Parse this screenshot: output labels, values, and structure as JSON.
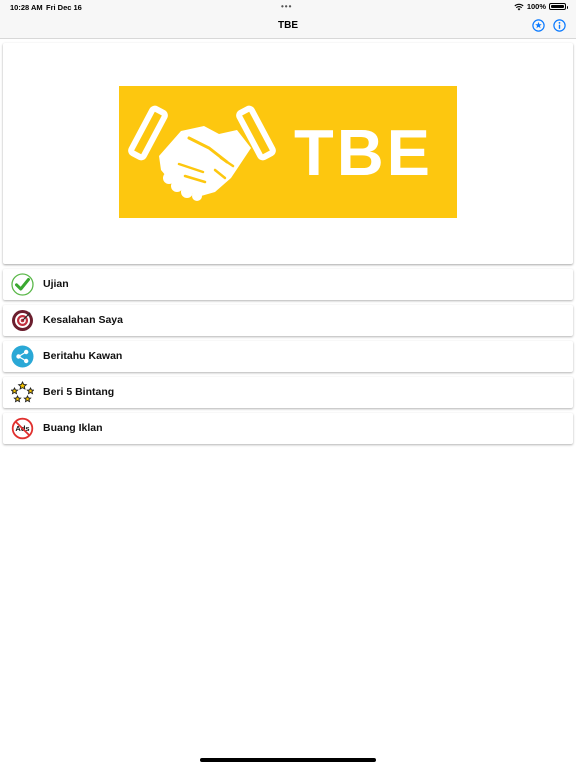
{
  "status_bar": {
    "time": "10:28 AM",
    "date": "Fri Dec 16",
    "battery": "100%"
  },
  "nav_bar": {
    "title": "TBE",
    "icons": {
      "favorite": "star-circle-icon",
      "info": "info-circle-icon"
    },
    "accent_color": "#0a7aff"
  },
  "banner": {
    "logo_text": "TBE",
    "logo_color": "#fdc70f",
    "logo_icon": "handshake-icon"
  },
  "menu": {
    "items": [
      {
        "label": "Ujian",
        "icon": "checkmark-icon"
      },
      {
        "label": "Kesalahan Saya",
        "icon": "target-icon"
      },
      {
        "label": "Beritahu Kawan",
        "icon": "share-icon"
      },
      {
        "label": "Beri 5 Bintang",
        "icon": "stars-ring-icon"
      },
      {
        "label": "Buang Iklan",
        "icon": "no-ads-icon"
      }
    ]
  }
}
